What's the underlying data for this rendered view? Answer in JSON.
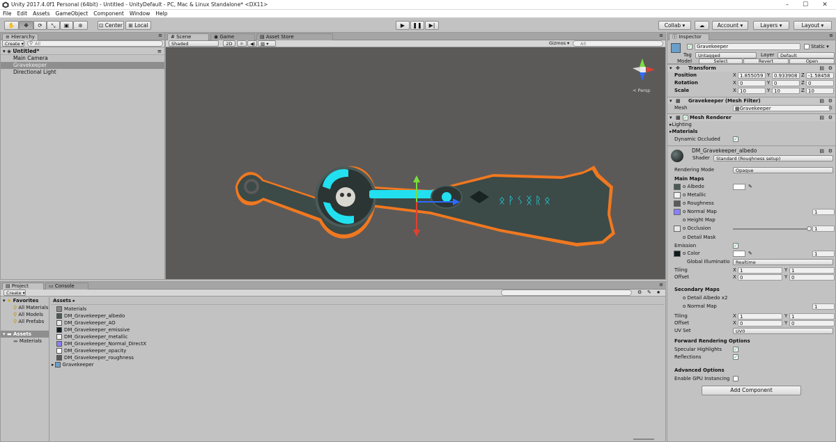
{
  "window": {
    "title": "Unity 2017.4.0f1 Personal (64bit) - Untitled - UnityDefault - PC, Mac & Linux Standalone* <DX11>",
    "controls": [
      "–",
      "☐",
      "✕"
    ]
  },
  "menu": [
    "File",
    "Edit",
    "Assets",
    "GameObject",
    "Component",
    "Window",
    "Help"
  ],
  "toolbar": {
    "center_label": "Center",
    "local_label": "Local",
    "collab_label": "Collab ▾",
    "account_label": "Account",
    "layers_label": "Layers",
    "layout_label": "Layout"
  },
  "hierarchy": {
    "tab": "Hierarchy",
    "create": "Create ▾",
    "search_placeholder": "All",
    "scene_name": "Untitled*",
    "objects": [
      "Main Camera",
      "Gravekeeper",
      "Directional Light"
    ]
  },
  "scene": {
    "tabs": [
      "Scene",
      "Game",
      "Asset Store"
    ],
    "shading": "Shaded",
    "mode_2d": "2D",
    "gizmos": "Gizmos ▾",
    "search_placeholder": "All",
    "persp_label": "≺ Persp",
    "glyphs": "ᛟᚹᛊᛝᚱᛟ"
  },
  "project": {
    "tabs": [
      "Project",
      "Console"
    ],
    "create": "Create ▾",
    "favorites_label": "Favorites",
    "favorites": [
      "All Materials",
      "All Models",
      "All Prefabs"
    ],
    "assets_label": "Assets",
    "assets_folders": [
      "Materials"
    ],
    "breadcrumb": "Assets ▸",
    "items": [
      {
        "name": "Materials",
        "color": "#888888"
      },
      {
        "name": "DM_Gravekeeper_albedo",
        "color": "#4a5a55"
      },
      {
        "name": "DM_Gravekeeper_AO",
        "color": "#e8e8e8"
      },
      {
        "name": "DM_Gravekeeper_emissive",
        "color": "#0e1a1c"
      },
      {
        "name": "DM_Gravekeeper_metallic",
        "color": "#f2f2f2"
      },
      {
        "name": "DM_Gravekeeper_Normal_DirectX",
        "color": "#8a80ff"
      },
      {
        "name": "DM_Gravekeeper_opacity",
        "color": "#ffffff"
      },
      {
        "name": "DM_Gravekeeper_roughness",
        "color": "#5a5a5a"
      },
      {
        "name": "Gravekeeper",
        "color": "#6aa0c8"
      }
    ]
  },
  "inspector": {
    "tab": "Inspector",
    "object_name": "Gravekeeper",
    "static_label": "Static ▾",
    "tag_label": "Tag",
    "tag_value": "Untagged",
    "layer_label": "Layer",
    "layer_value": "Default",
    "model_label": "Model",
    "model_buttons": [
      "Select",
      "Revert",
      "Open"
    ],
    "transform": {
      "title": "Transform",
      "rows": [
        {
          "label": "Position",
          "x": "1.855059",
          "y": "0.933908",
          "z": "-1.58458"
        },
        {
          "label": "Rotation",
          "x": "0",
          "y": "0",
          "z": "0"
        },
        {
          "label": "Scale",
          "x": "10",
          "y": "10",
          "z": "10"
        }
      ]
    },
    "mesh_filter": {
      "title": "Gravekeeper (Mesh Filter)",
      "mesh_label": "Mesh",
      "mesh_value": "Gravekeeper"
    },
    "mesh_renderer": {
      "title": "Mesh Renderer",
      "lighting": "Lighting",
      "materials": "Materials",
      "dynamic_occluded": "Dynamic Occluded"
    },
    "material": {
      "name": "DM_Gravekeeper_albedo",
      "shader_label": "Shader",
      "shader_value": "Standard (Roughness setup)",
      "rendering_mode_label": "Rendering Mode",
      "rendering_mode_value": "Opaque",
      "main_maps": "Main Maps",
      "albedo": "Albedo",
      "metallic": "Metallic",
      "roughness": "Roughness",
      "normal_map": "Normal Map",
      "normal_value": "1",
      "height_map": "Height Map",
      "occlusion": "Occlusion",
      "occlusion_value": "1",
      "detail_mask": "Detail Mask",
      "emission": "Emission",
      "color": "Color",
      "color_value": "1",
      "gi_label": "Global Illuminatio",
      "gi_value": "Realtime",
      "tiling": "Tiling",
      "offset": "Offset",
      "tiling_x": "1",
      "tiling_y": "1",
      "offset_x": "0",
      "offset_y": "0",
      "secondary_maps": "Secondary Maps",
      "detail_albedo": "Detail Albedo x2",
      "normal_map2": "Normal Map",
      "normal_value2": "1",
      "tiling2_x": "1",
      "tiling2_y": "1",
      "offset2_x": "0",
      "offset2_y": "0",
      "uv_set_label": "UV Set",
      "uv_set_value": "UV0",
      "forward_options": "Forward Rendering Options",
      "specular_highlights": "Specular Highlights",
      "reflections": "Reflections",
      "advanced_options": "Advanced Options",
      "gpu_instancing": "Enable GPU Instancing"
    },
    "add_component": "Add Component"
  },
  "colors": {
    "panel_bg": "#c2c2c2",
    "scene_bg": "#5c5a58",
    "selection": "#8e8e8e",
    "outline": "#f07820",
    "glow": "#22e0f0"
  }
}
